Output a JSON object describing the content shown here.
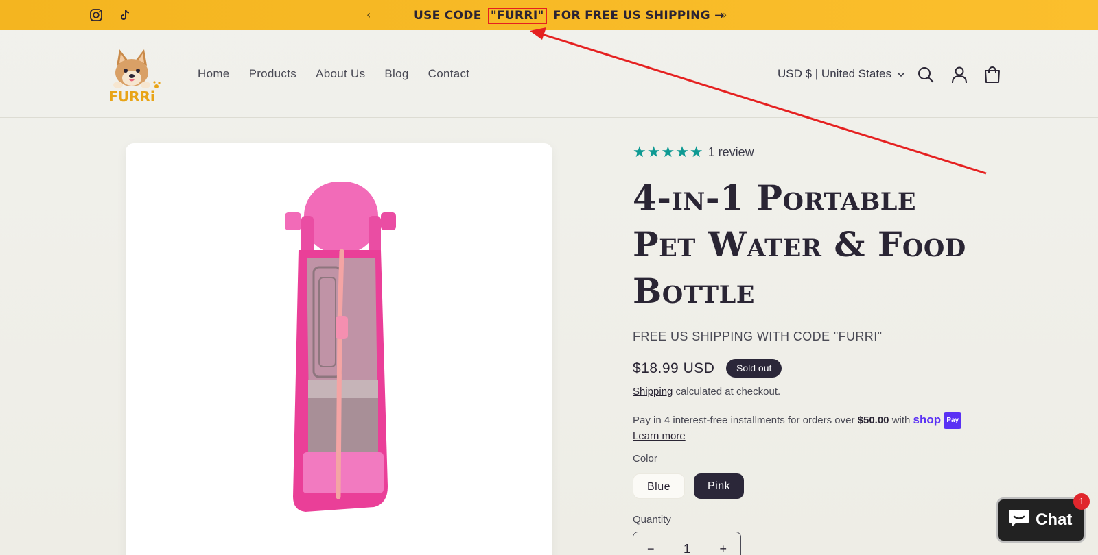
{
  "announcement": {
    "prefix": "USE CODE",
    "code": "\"FURRI\"",
    "suffix": "FOR FREE US SHIPPING →",
    "prev_arrow": "‹",
    "next_arrow": "›"
  },
  "social": [
    {
      "icon": "instagram-icon"
    },
    {
      "icon": "tiktok-icon"
    }
  ],
  "header": {
    "logo_icon": "furri-dog-logo",
    "nav": [
      "Home",
      "Products",
      "About Us",
      "Blog",
      "Contact"
    ],
    "currency": "USD $ | United States",
    "icons": [
      "search-icon",
      "account-icon",
      "cart-icon"
    ]
  },
  "product": {
    "rating_stars": "★★★★★",
    "rating": 5,
    "review_text": "1 review",
    "title": "4-in-1 Portable Pet Water & Food Bottle",
    "promo": "FREE US SHIPPING WITH CODE \"FURRI\"",
    "price": "$18.99 USD",
    "badge": "Sold out",
    "shipping_link": "Shipping",
    "shipping_rest": " calculated at checkout.",
    "pay_prefix": "Pay in 4 interest-free installments for orders over ",
    "pay_amount": "$50.00",
    "pay_with": " with ",
    "shop_text": "shop",
    "pay_chip": "Pay",
    "learn_more": "Learn more",
    "color_label": "Color",
    "colors": [
      "Blue",
      "Pink"
    ],
    "selected_color": "Pink",
    "quantity_label": "Quantity",
    "quantity_minus": "−",
    "quantity": "1",
    "quantity_plus": "+"
  },
  "chat": {
    "label": "Chat",
    "badge": "1"
  },
  "colors": {
    "announcement_bg": "#fbbf2d",
    "star": "#0e9a93",
    "badge_bg": "#2b2739",
    "annotation": "#e52020",
    "shop_pay": "#5a31f4",
    "bottle": "#f25db0"
  }
}
